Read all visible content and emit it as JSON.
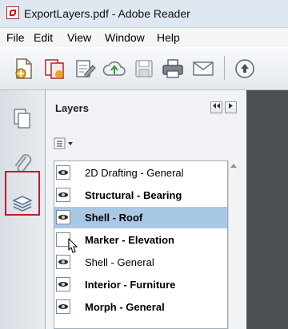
{
  "window": {
    "title": "ExportLayers.pdf - Adobe Reader"
  },
  "menu": {
    "items": [
      "File",
      "Edit",
      "View",
      "Window",
      "Help"
    ]
  },
  "toolbar": {
    "icons": [
      "create-pdf-icon",
      "combine-files-icon",
      "sign-icon",
      "upload-cloud-icon",
      "save-icon",
      "print-icon",
      "email-icon",
      "previous-page-icon"
    ]
  },
  "navigation": {
    "items": [
      "pages-icon",
      "attachments-icon",
      "layers-icon"
    ],
    "active": "layers-icon",
    "highlight_color": "#c41a2a"
  },
  "layers_panel": {
    "title": "Layers",
    "layers": [
      {
        "label": "2D Drafting - General",
        "bold": false,
        "visible": true,
        "selected": false
      },
      {
        "label": "Structural - Bearing",
        "bold": true,
        "visible": true,
        "selected": false
      },
      {
        "label": "Shell - Roof",
        "bold": true,
        "visible": true,
        "selected": true
      },
      {
        "label": "Marker - Elevation",
        "bold": true,
        "visible": false,
        "selected": false
      },
      {
        "label": "Shell - General",
        "bold": false,
        "visible": true,
        "selected": false
      },
      {
        "label": "Interior - Furniture",
        "bold": true,
        "visible": true,
        "selected": false
      },
      {
        "label": "Morph - General",
        "bold": true,
        "visible": true,
        "selected": false
      }
    ],
    "selection_color": "#a9c8e6"
  }
}
